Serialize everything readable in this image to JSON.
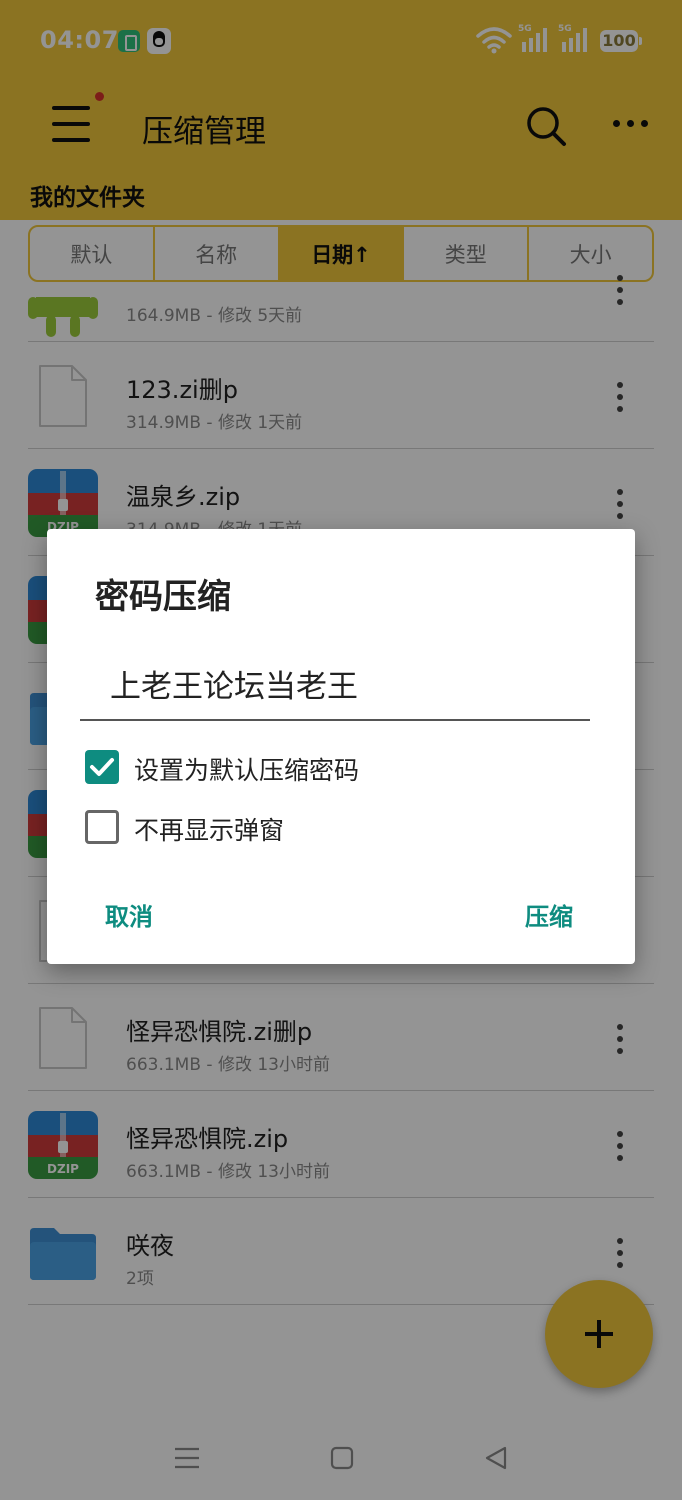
{
  "status_bar": {
    "time": "04:07",
    "signal1_label": "5G",
    "signal2_label": "5G",
    "battery": "100"
  },
  "app_bar": {
    "title": "压缩管理",
    "folder_label": "我的文件夹"
  },
  "sort_tabs": [
    {
      "label": "默认",
      "active": false
    },
    {
      "label": "名称",
      "active": false
    },
    {
      "label": "日期↑",
      "active": true
    },
    {
      "label": "类型",
      "active": false
    },
    {
      "label": "大小",
      "active": false
    }
  ],
  "files": [
    {
      "name": "",
      "meta": "164.9MB - 修改 5天前",
      "icon": "android-apk-icon"
    },
    {
      "name": "123.zi删p",
      "meta": "314.9MB - 修改 1天前",
      "icon": "blank-file-icon"
    },
    {
      "name": "温泉乡.zip",
      "meta": "314.9MB - 修改 1天前",
      "icon": "zip-archive-icon"
    },
    {
      "name": "",
      "meta": "",
      "icon": "zip-archive-icon"
    },
    {
      "name": "",
      "meta": "",
      "icon": "folder-icon"
    },
    {
      "name": "",
      "meta": "",
      "icon": "zip-archive-icon"
    },
    {
      "name": "",
      "meta": "",
      "icon": "blank-file-icon"
    },
    {
      "name": "怪异恐惧院.zi删p",
      "meta": "663.1MB - 修改 13小时前",
      "icon": "blank-file-icon"
    },
    {
      "name": "怪异恐惧院.zip",
      "meta": "663.1MB - 修改 13小时前",
      "icon": "zip-archive-icon"
    },
    {
      "name": "咲夜",
      "meta": "2项",
      "icon": "folder-icon"
    }
  ],
  "zip_icon_label": "DZIP",
  "dialog": {
    "title": "密码压缩",
    "password_value": "上老王论坛当老王",
    "checkbox_default": {
      "label": "设置为默认压缩密码",
      "checked": true
    },
    "checkbox_no_popup": {
      "label": "不再显示弹窗",
      "checked": false
    },
    "cancel_label": "取消",
    "confirm_label": "压缩"
  },
  "colors": {
    "brand_yellow": "#f0c63c",
    "accent_teal": "#0e8c80"
  }
}
